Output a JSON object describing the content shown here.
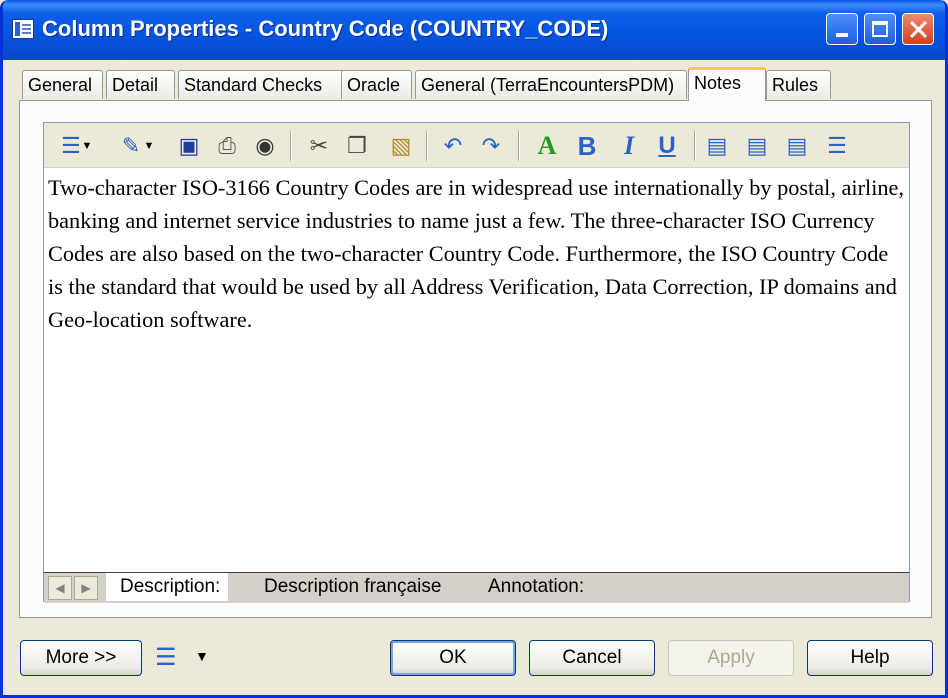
{
  "window": {
    "title": "Column Properties - Country Code (COUNTRY_CODE)"
  },
  "tabs": [
    {
      "label": "General"
    },
    {
      "label": "Detail"
    },
    {
      "label": "Standard Checks"
    },
    {
      "label": "Oracle"
    },
    {
      "label": "General (TerraEncountersPDM)"
    },
    {
      "label": "Notes",
      "active": true
    },
    {
      "label": "Rules"
    }
  ],
  "toolbar": {
    "icons": [
      "model-icon",
      "chevron-down-icon",
      "edit-icon",
      "chevron-down-icon",
      "save-icon",
      "print-icon",
      "find-icon",
      "cut-icon",
      "copy-icon",
      "paste-icon",
      "undo-icon",
      "redo-icon",
      "font-color-icon",
      "bold-icon",
      "italic-icon",
      "underline-icon",
      "align-left-icon",
      "align-center-icon",
      "align-right-icon",
      "bullets-icon"
    ],
    "font_color_label": "A",
    "bold_label": "B",
    "italic_label": "I",
    "underline_label": "U"
  },
  "editor": {
    "text": "Two-character ISO-3166 Country Codes are in widespread use internationally by postal, airline, banking and internet service industries to name just a few.  The three-character ISO Currency Codes are also based on the two-character Country Code.  Furthermore, the ISO Country Code is the standard that would be used by all Address Verification, Data Correction, IP domains and Geo-location software."
  },
  "bottom_tabs": [
    {
      "label": "Description:",
      "active": true
    },
    {
      "label": "Description française"
    },
    {
      "label": "Annotation:"
    }
  ],
  "buttons": {
    "more": "More >>",
    "ok": "OK",
    "cancel": "Cancel",
    "apply": "Apply",
    "help": "Help"
  },
  "colors": {
    "title_bar": "#0554e0",
    "active_tab_accent": "#ffc73c",
    "dialog_bg": "#ece9d8"
  }
}
